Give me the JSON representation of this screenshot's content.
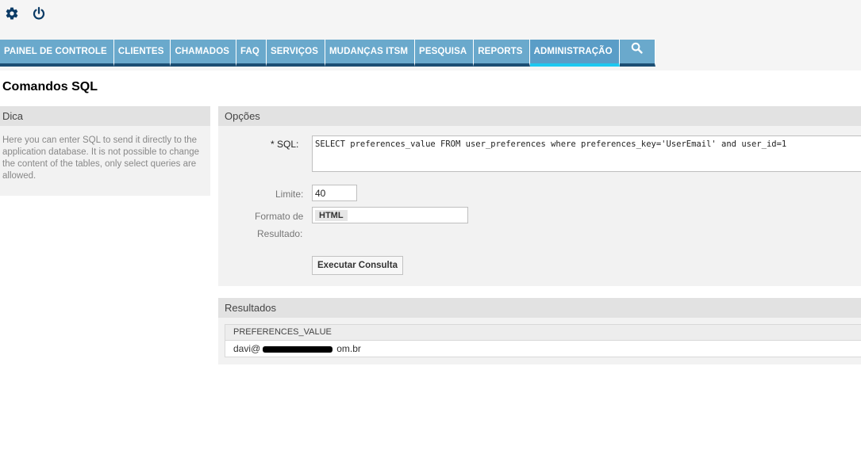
{
  "toolbar": {
    "icons": [
      "gear-icon",
      "power-icon"
    ],
    "icon_color": "#0b3b66"
  },
  "nav": {
    "items": [
      {
        "label": "PAINEL DE CONTROLE"
      },
      {
        "label": "CLIENTES"
      },
      {
        "label": "CHAMADOS"
      },
      {
        "label": "FAQ"
      },
      {
        "label": "SERVIÇOS"
      },
      {
        "label": "MUDANÇAS ITSM"
      },
      {
        "label": "PESQUISA"
      },
      {
        "label": "REPORTS"
      },
      {
        "label": "ADMINISTRAÇÃO",
        "active": true
      }
    ],
    "search_icon": "search-icon",
    "colors": {
      "bar": "#6aa9cc",
      "underline": "#1c4e73",
      "active_underline": "#1ec8f0"
    }
  },
  "page": {
    "title": "Comandos SQL"
  },
  "hint": {
    "header": "Dica",
    "text": "Here you can enter SQL to send it directly to the application database. It is not possible to change the content of the tables, only select queries are allowed."
  },
  "options": {
    "header": "Opções",
    "sql_label": "SQL:",
    "required_marker": "*",
    "sql_value": "SELECT preferences_value FROM user_preferences where preferences_key='UserEmail' and user_id=1",
    "limit_label": "Limite:",
    "limit_value": "40",
    "format_label_line1": "Formato de",
    "format_label_line2": "Resultado:",
    "format_value": "HTML",
    "execute_label": "Executar Consulta"
  },
  "results": {
    "header": "Resultados",
    "columns": [
      "PREFERENCES_VALUE"
    ],
    "rows": [
      {
        "prefix": "davi@",
        "suffix": "om.br"
      }
    ]
  }
}
